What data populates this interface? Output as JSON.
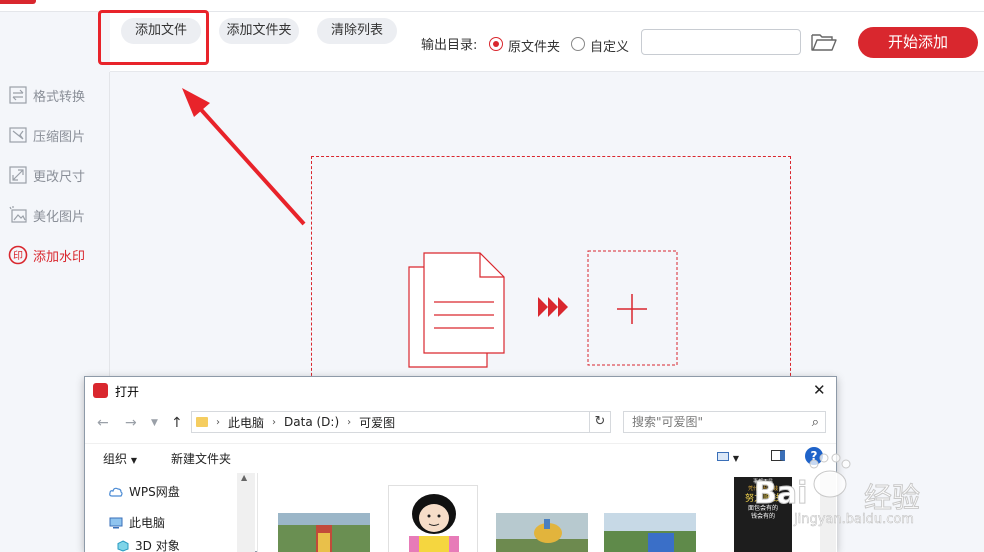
{
  "toolbar": {
    "add_file": "添加文件",
    "add_folder": "添加文件夹",
    "clear_list": "清除列表",
    "output_dir_label": "输出目录:",
    "option_original": "原文件夹",
    "option_custom": "自定义",
    "start": "开始添加"
  },
  "sidebar": {
    "items": [
      {
        "label": "格式转换",
        "icon": "swap-icon"
      },
      {
        "label": "压缩图片",
        "icon": "compress-icon"
      },
      {
        "label": "更改尺寸",
        "icon": "resize-icon"
      },
      {
        "label": "美化图片",
        "icon": "beautify-icon"
      },
      {
        "label": "添加水印",
        "icon": "stamp-icon"
      }
    ],
    "stamp_glyph": "印"
  },
  "dialog": {
    "title": "打开",
    "path": [
      "此电脑",
      "Data (D:)",
      "可爱图"
    ],
    "search_placeholder": "搜索\"可爱图\"",
    "organize": "组织",
    "new_folder": "新建文件夹",
    "tree": [
      "WPS网盘",
      "此电脑",
      "3D 对象"
    ],
    "book_lines": [
      "事都不是",
      "凭什么乱花钱",
      "努力赚钱",
      "面包会有的",
      "钱会有的"
    ]
  },
  "watermark": {
    "logo_text": "Bai",
    "logo_suffix": "经验",
    "url": "jingyan.baidu.com"
  },
  "colors": {
    "accent": "#d9272e",
    "highlight": "#e8232a"
  }
}
